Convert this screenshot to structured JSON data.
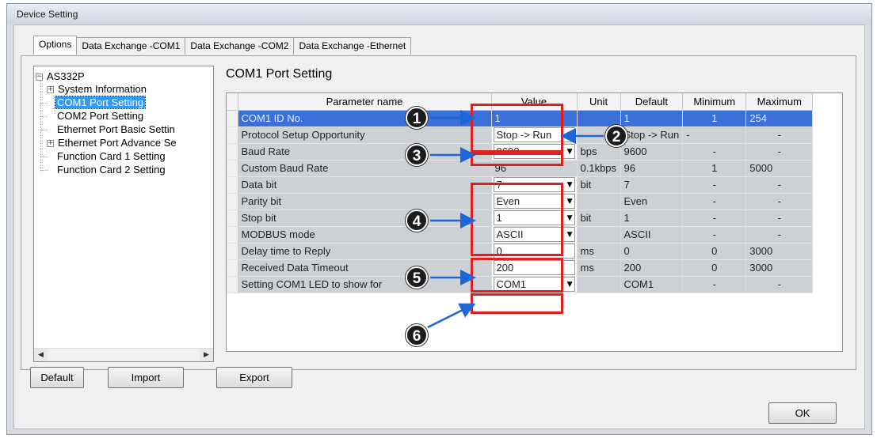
{
  "window": {
    "title": "Device Setting"
  },
  "tabs": [
    "Options",
    "Data Exchange -COM1",
    "Data Exchange -COM2",
    "Data Exchange -Ethernet"
  ],
  "tree": {
    "root": "AS332P",
    "items": [
      {
        "label": "System Information",
        "expandable": true
      },
      {
        "label": "COM1 Port Setting",
        "selected": true
      },
      {
        "label": "COM2 Port Setting"
      },
      {
        "label": "Ethernet Port Basic Settin"
      },
      {
        "label": "Ethernet Port Advance Se",
        "expandable": true
      },
      {
        "label": "Function Card 1 Setting"
      },
      {
        "label": "Function Card 2 Setting"
      }
    ]
  },
  "section_title": "COM1 Port Setting",
  "grid": {
    "columns": [
      "Parameter name",
      "Value",
      "Unit",
      "Default",
      "Minimum",
      "Maximum"
    ],
    "rows": [
      {
        "name": "COM1 ID No.",
        "value": "1",
        "kind": "readonly",
        "unit": "",
        "default": "1",
        "min": "1",
        "max": "254",
        "selected": true
      },
      {
        "name": "Protocol Setup Opportunity",
        "value": "Stop -> Run",
        "kind": "dropdown",
        "unit": "",
        "default": "Stop -> Run",
        "min": "-",
        "max": "-"
      },
      {
        "name": "Baud Rate",
        "value": "9600",
        "kind": "dropdown",
        "unit": "bps",
        "default": "9600",
        "min": "-",
        "max": "-"
      },
      {
        "name": "Custom Baud Rate",
        "value": "96",
        "kind": "readonly",
        "unit": "0.1kbps",
        "default": "96",
        "min": "1",
        "max": "5000"
      },
      {
        "name": "Data bit",
        "value": "7",
        "kind": "dropdown",
        "unit": "bit",
        "default": "7",
        "min": "-",
        "max": "-"
      },
      {
        "name": "Parity bit",
        "value": "Even",
        "kind": "dropdown",
        "unit": "",
        "default": "Even",
        "min": "-",
        "max": "-"
      },
      {
        "name": "Stop bit",
        "value": "1",
        "kind": "dropdown",
        "unit": "bit",
        "default": "1",
        "min": "-",
        "max": "-"
      },
      {
        "name": "MODBUS mode",
        "value": "ASCII",
        "kind": "dropdown",
        "unit": "",
        "default": "ASCII",
        "min": "-",
        "max": "-"
      },
      {
        "name": "Delay time to Reply",
        "value": "0",
        "kind": "textbox",
        "unit": "ms",
        "default": "0",
        "min": "0",
        "max": "3000"
      },
      {
        "name": "Received Data Timeout",
        "value": "200",
        "kind": "textbox",
        "unit": "ms",
        "default": "200",
        "min": "0",
        "max": "3000"
      },
      {
        "name": "Setting COM1 LED to show for",
        "value": "COM1",
        "kind": "dropdown",
        "unit": "",
        "default": "COM1",
        "min": "-",
        "max": "-"
      }
    ]
  },
  "callouts": [
    "1",
    "2",
    "3",
    "4",
    "5",
    "6"
  ],
  "buttons": {
    "default": "Default",
    "import": "Import",
    "export": "Export",
    "ok": "OK"
  },
  "icons": {
    "expand": "plus-box-icon",
    "collapse": "minus-box-icon",
    "dropdown": "dropdown-arrow-icon",
    "scroll_left": "scroll-left-icon",
    "scroll_right": "scroll-right-icon"
  },
  "colors": {
    "selection": "#3c6fd7",
    "tree_selection": "#3399ff",
    "callout_box": "#e02020",
    "callout_arrow": "#1e66d8"
  }
}
